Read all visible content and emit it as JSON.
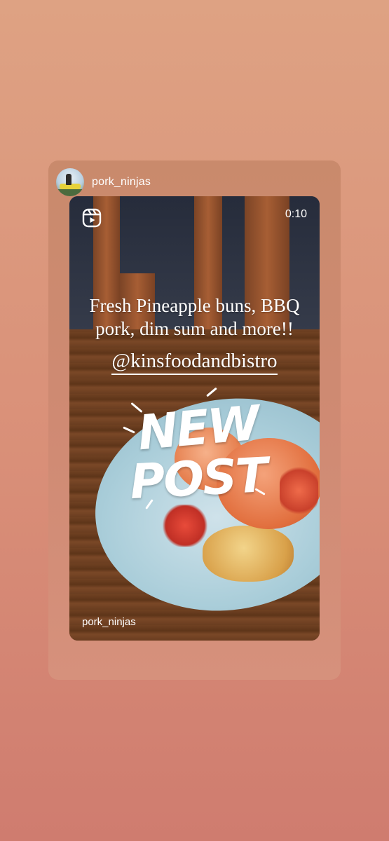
{
  "story": {
    "username": "pork_ninjas",
    "avatar_icon": "profile-avatar-photo"
  },
  "reel": {
    "icon": "reels-icon",
    "duration": "0:10",
    "caption": "Fresh Pineapple buns, BBQ pork, dim sum and more!!",
    "mention": "@kinsfoodandbistro",
    "sticker_line1": "NEW",
    "sticker_line2": "POST",
    "username": "pork_ninjas"
  }
}
